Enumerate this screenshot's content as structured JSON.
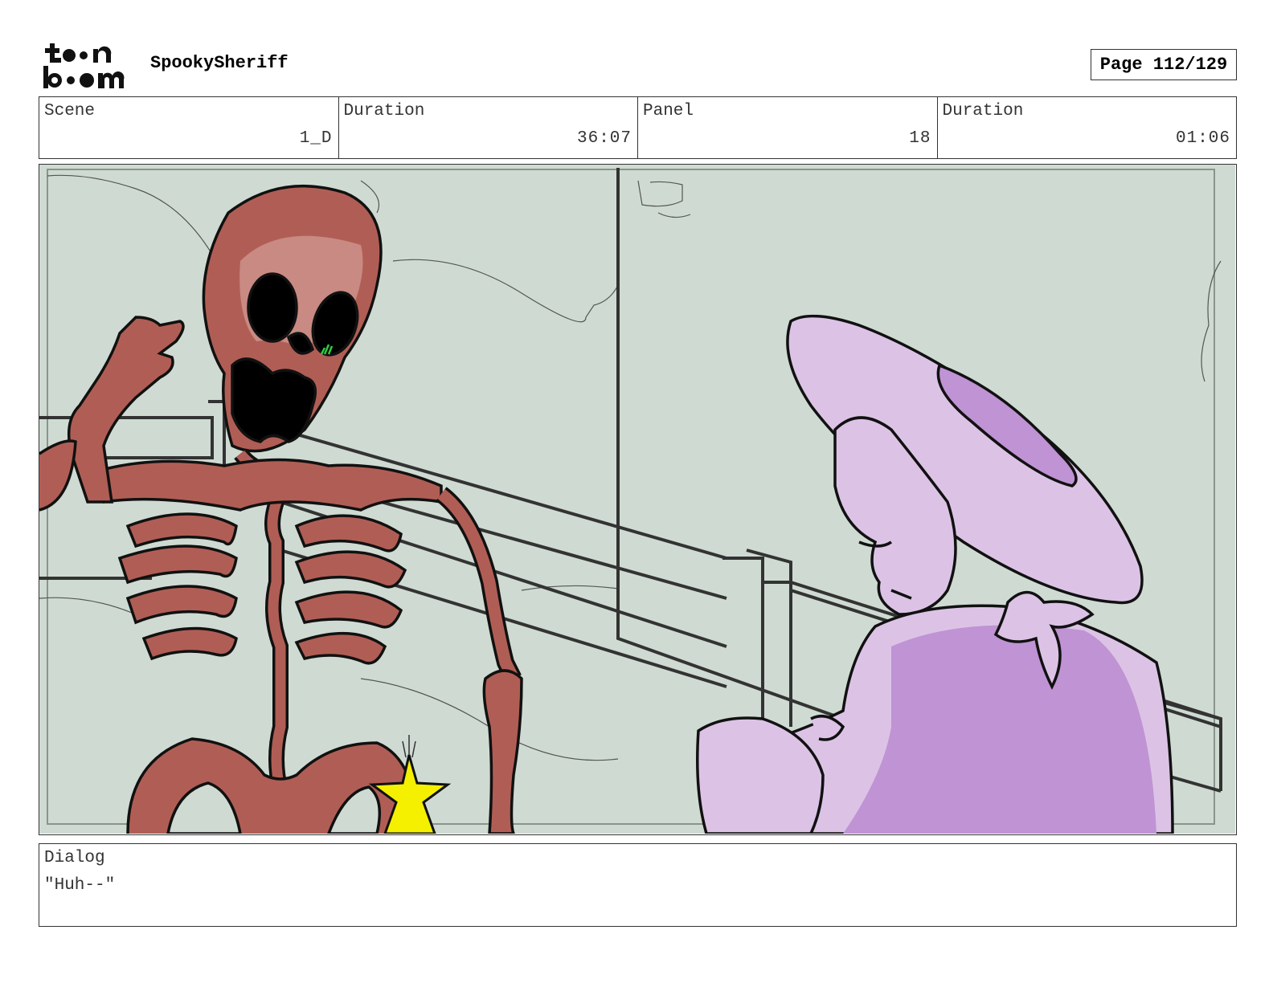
{
  "header": {
    "logo_text": "toonboom",
    "project_title": "SpookySheriff",
    "page_label": "Page 112/129"
  },
  "info": {
    "scene": {
      "label": "Scene",
      "value": "1_D"
    },
    "scene_duration": {
      "label": "Duration",
      "value": "36:07"
    },
    "panel": {
      "label": "Panel",
      "value": "18"
    },
    "panel_duration": {
      "label": "Duration",
      "value": "01:06"
    }
  },
  "dialog": {
    "label": "Dialog",
    "text": "\"Huh--\""
  },
  "colors": {
    "background_scene": "#cfdbd2",
    "skeleton": "#b05e55",
    "skeleton_shade": "#c98a83",
    "character": "#dcc3e6",
    "character_shade": "#bf93d4",
    "star": "#f5f000",
    "eye_glow": "#2ecc40"
  }
}
